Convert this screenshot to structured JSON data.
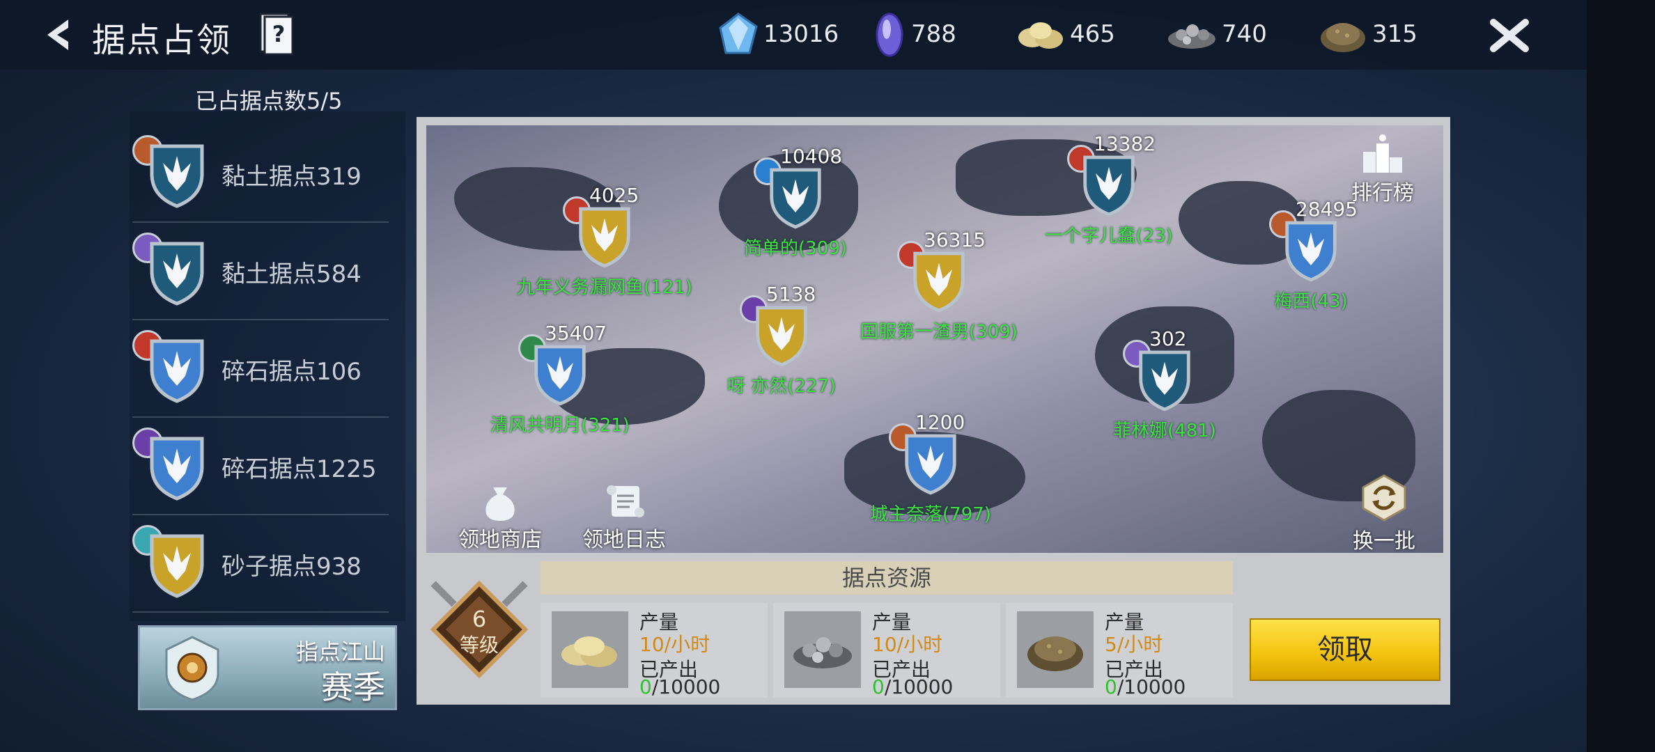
{
  "header": {
    "title": "据点占领"
  },
  "resources": [
    {
      "icon": "blue-crystal-icon",
      "value": "13016"
    },
    {
      "icon": "purple-crystal-icon",
      "value": "788"
    },
    {
      "icon": "clay-pile-icon",
      "value": "465"
    },
    {
      "icon": "gravel-pile-icon",
      "value": "740"
    },
    {
      "icon": "sand-pile-icon",
      "value": "315"
    }
  ],
  "sidebar": {
    "occupied_label": "已占据点数5/5",
    "items": [
      {
        "label": "黏土据点319",
        "shield": "blue",
        "badge": "fire"
      },
      {
        "label": "黏土据点584",
        "shield": "blue",
        "badge": "arcane"
      },
      {
        "label": "碎石据点106",
        "shield": "light-blue",
        "badge": "fire"
      },
      {
        "label": "碎石据点1225",
        "shield": "light-blue",
        "badge": "arcane"
      },
      {
        "label": "砂子据点938",
        "shield": "gold",
        "badge": "water"
      }
    ],
    "season": {
      "line1": "指点江山",
      "line2": "赛季"
    }
  },
  "map": {
    "nodes": [
      {
        "count": "4025",
        "owner": "九年义务漏网鱼(121)",
        "shield": "gold"
      },
      {
        "count": "10408",
        "owner": "简单的(309)",
        "shield": "blue"
      },
      {
        "count": "13382",
        "owner": "一个字儿蠢(23)",
        "shield": "blue"
      },
      {
        "count": "36315",
        "owner": "国服第一渣男(309)",
        "shield": "gold"
      },
      {
        "count": "28495",
        "owner": "梅西(43)",
        "shield": "light-blue"
      },
      {
        "count": "5138",
        "owner": "呀 亦然(227)",
        "shield": "gold"
      },
      {
        "count": "35407",
        "owner": "清风共明月(321)",
        "shield": "light-blue"
      },
      {
        "count": "302",
        "owner": "菲林娜(481)",
        "shield": "blue"
      },
      {
        "count": "1200",
        "owner": "城主奈落(797)",
        "shield": "light-blue"
      }
    ],
    "ranking_label": "排行榜",
    "shop_label": "领地商店",
    "log_label": "领地日志",
    "refresh_label": "换一批"
  },
  "level": {
    "value": "6",
    "label": "等级"
  },
  "resource_panel": {
    "title": "据点资源",
    "cards": [
      {
        "prod_label": "产量",
        "rate": "10/小时",
        "produced_label": "已产出",
        "produced": "0",
        "max": "/10000",
        "icon": "clay-pile-icon"
      },
      {
        "prod_label": "产量",
        "rate": "10/小时",
        "produced_label": "已产出",
        "produced": "0",
        "max": "/10000",
        "icon": "gravel-pile-icon"
      },
      {
        "prod_label": "产量",
        "rate": "5/小时",
        "produced_label": "已产出",
        "produced": "0",
        "max": "/10000",
        "icon": "sand-pile-icon"
      }
    ],
    "claim_label": "领取"
  },
  "colors": {
    "green_text": "#3ee23e",
    "accent_yellow": "#f2c20d",
    "rate_orange": "#d08a18"
  }
}
